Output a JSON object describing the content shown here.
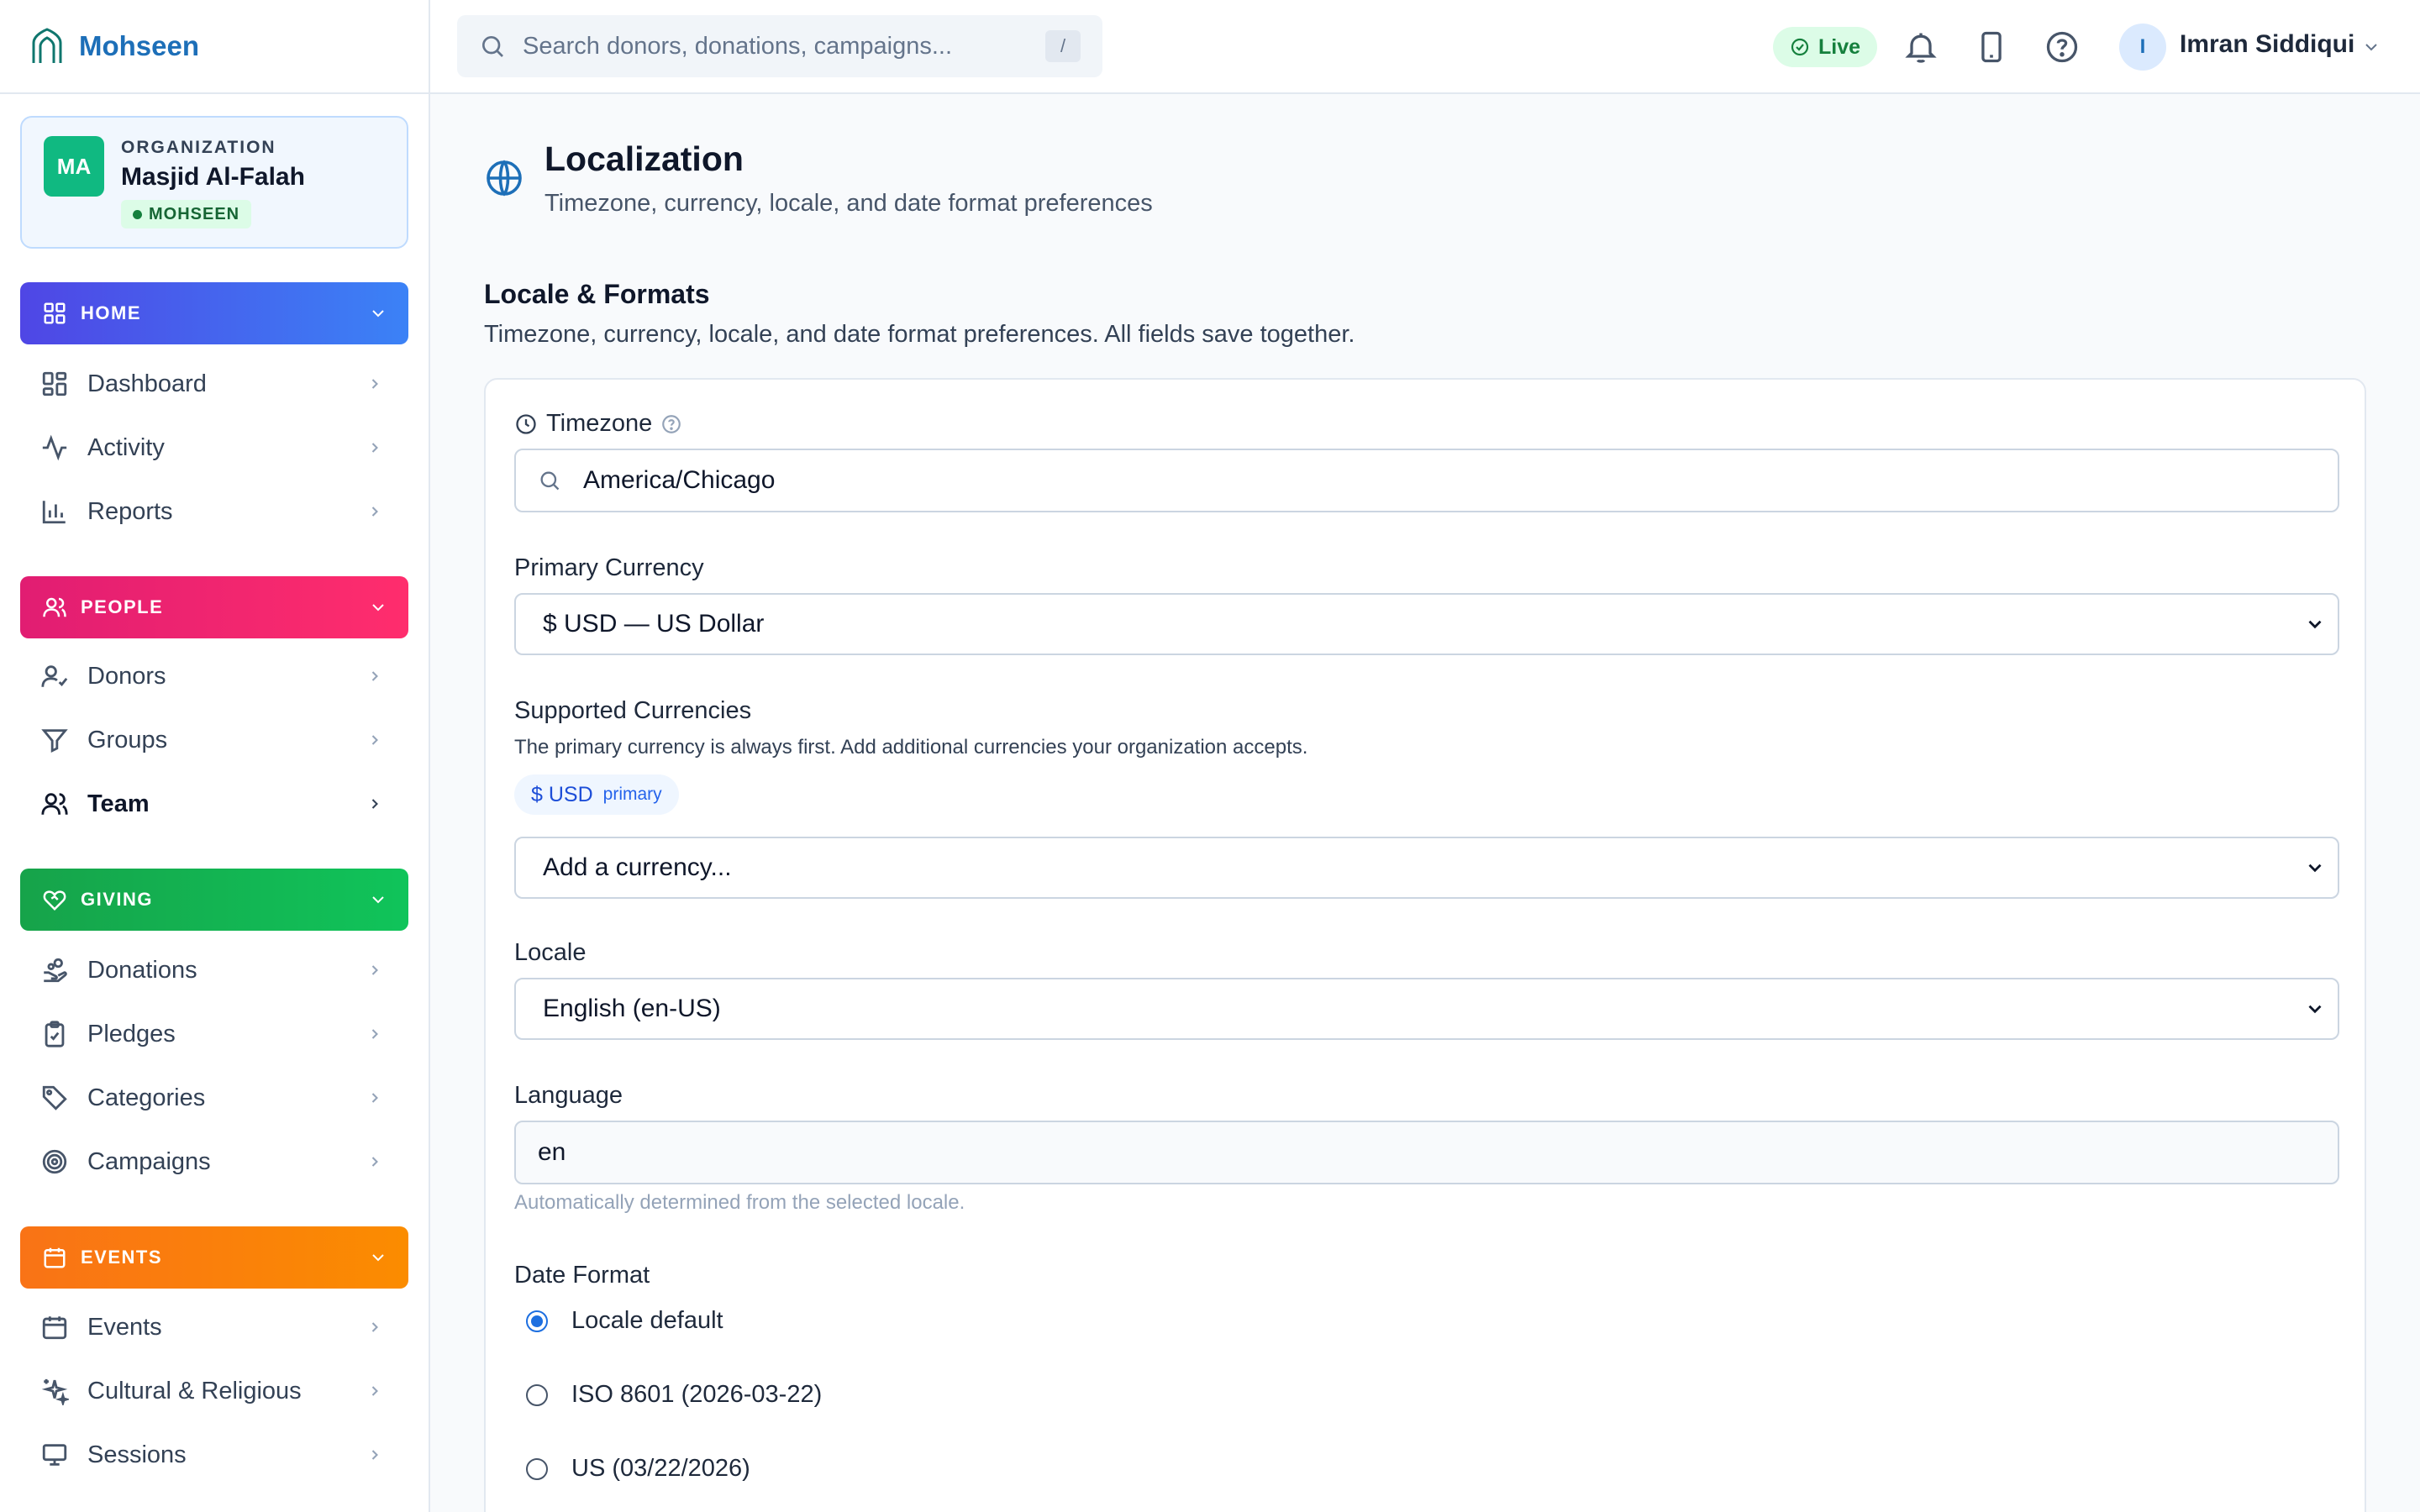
{
  "brand": {
    "name": "Mohseen"
  },
  "org": {
    "initials": "MA",
    "label": "ORGANIZATION",
    "name": "Masjid Al-Falah",
    "badge": "MOHSEEN"
  },
  "sections": {
    "home": {
      "label": "HOME",
      "items": [
        {
          "label": "Dashboard",
          "icon": "dashboard-grid-icon"
        },
        {
          "label": "Activity",
          "icon": "activity-pulse-icon"
        },
        {
          "label": "Reports",
          "icon": "bar-chart-icon"
        }
      ]
    },
    "people": {
      "label": "PEOPLE",
      "items": [
        {
          "label": "Donors",
          "icon": "user-check-icon"
        },
        {
          "label": "Groups",
          "icon": "funnel-icon"
        },
        {
          "label": "Team",
          "icon": "users-icon"
        }
      ]
    },
    "giving": {
      "label": "GIVING",
      "items": [
        {
          "label": "Donations",
          "icon": "hand-coins-icon"
        },
        {
          "label": "Pledges",
          "icon": "clipboard-check-icon"
        },
        {
          "label": "Categories",
          "icon": "tag-icon"
        },
        {
          "label": "Campaigns",
          "icon": "target-icon"
        }
      ]
    },
    "events": {
      "label": "EVENTS",
      "items": [
        {
          "label": "Events",
          "icon": "calendar-icon"
        },
        {
          "label": "Cultural & Religious",
          "icon": "sparkles-icon"
        },
        {
          "label": "Sessions",
          "icon": "monitor-icon"
        }
      ]
    }
  },
  "topbar": {
    "search_placeholder": "Search donors, donations, campaigns...",
    "search_shortcut": "/",
    "live_label": "Live",
    "user_initial": "I",
    "user_name": "Imran Siddiqui"
  },
  "page": {
    "title": "Localization",
    "subtitle": "Timezone, currency, locale, and date format preferences"
  },
  "section": {
    "title": "Locale & Formats",
    "description": "Timezone, currency, locale, and date format preferences. All fields save together."
  },
  "form": {
    "timezone": {
      "label": "Timezone",
      "value": "America/Chicago"
    },
    "primary_currency": {
      "label": "Primary Currency",
      "value": "$ USD — US Dollar"
    },
    "supported_currencies": {
      "label": "Supported Currencies",
      "help": "The primary currency is always first. Add additional currencies your organization accepts.",
      "chip_code": "$ USD",
      "chip_tag": "primary",
      "add_placeholder": "Add a currency..."
    },
    "locale": {
      "label": "Locale",
      "value": "English (en-US)"
    },
    "language": {
      "label": "Language",
      "value": "en",
      "hint": "Automatically determined from the selected locale."
    },
    "date_format": {
      "label": "Date Format",
      "options": [
        {
          "label": "Locale default",
          "checked": true
        },
        {
          "label": "ISO 8601 (2026-03-22)",
          "checked": false
        },
        {
          "label": "US (03/22/2026)",
          "checked": false
        }
      ]
    }
  },
  "colors": {
    "brand": "#1d6fb8",
    "home": "#4f46e5",
    "people": "#e11d72",
    "giving": "#16a34a",
    "events": "#f97316",
    "live": "#15803d"
  }
}
